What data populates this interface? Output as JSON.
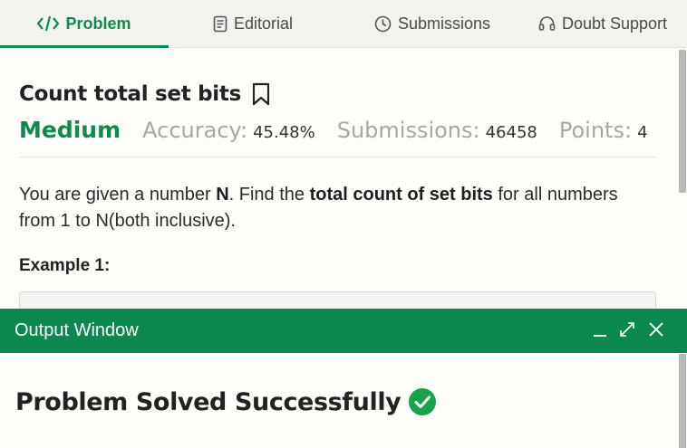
{
  "tabs": {
    "problem": "Problem",
    "editorial": "Editorial",
    "submissions": "Submissions",
    "doubt_support": "Doubt Support"
  },
  "problem": {
    "title": "Count total set bits",
    "difficulty": "Medium",
    "accuracy_label": "Accuracy:",
    "accuracy_value": "45.48%",
    "submissions_label": "Submissions:",
    "submissions_value": "46458",
    "points_label": "Points:",
    "points_value": "4",
    "description": {
      "p1": "You are given a number ",
      "b1": "N",
      "p2": ". Find the ",
      "b2": "total count of set bits",
      "p3": " for all numbers from 1 to N(both inclusive)."
    },
    "example_heading": "Example 1:"
  },
  "output_window": {
    "title": "Output Window",
    "status": "Problem Solved Successfully"
  },
  "icons": {
    "problem": "code-icon",
    "editorial": "document-icon",
    "submissions": "clock-icon",
    "doubt_support": "headset-icon",
    "bookmark": "bookmark-icon",
    "minimize": "minimize-icon",
    "expand": "expand-icon",
    "close": "close-icon",
    "success": "check-circle-icon"
  },
  "colors": {
    "accent": "#0f8a4f",
    "output_header": "#0a8850",
    "success_icon": "#16a34a"
  }
}
